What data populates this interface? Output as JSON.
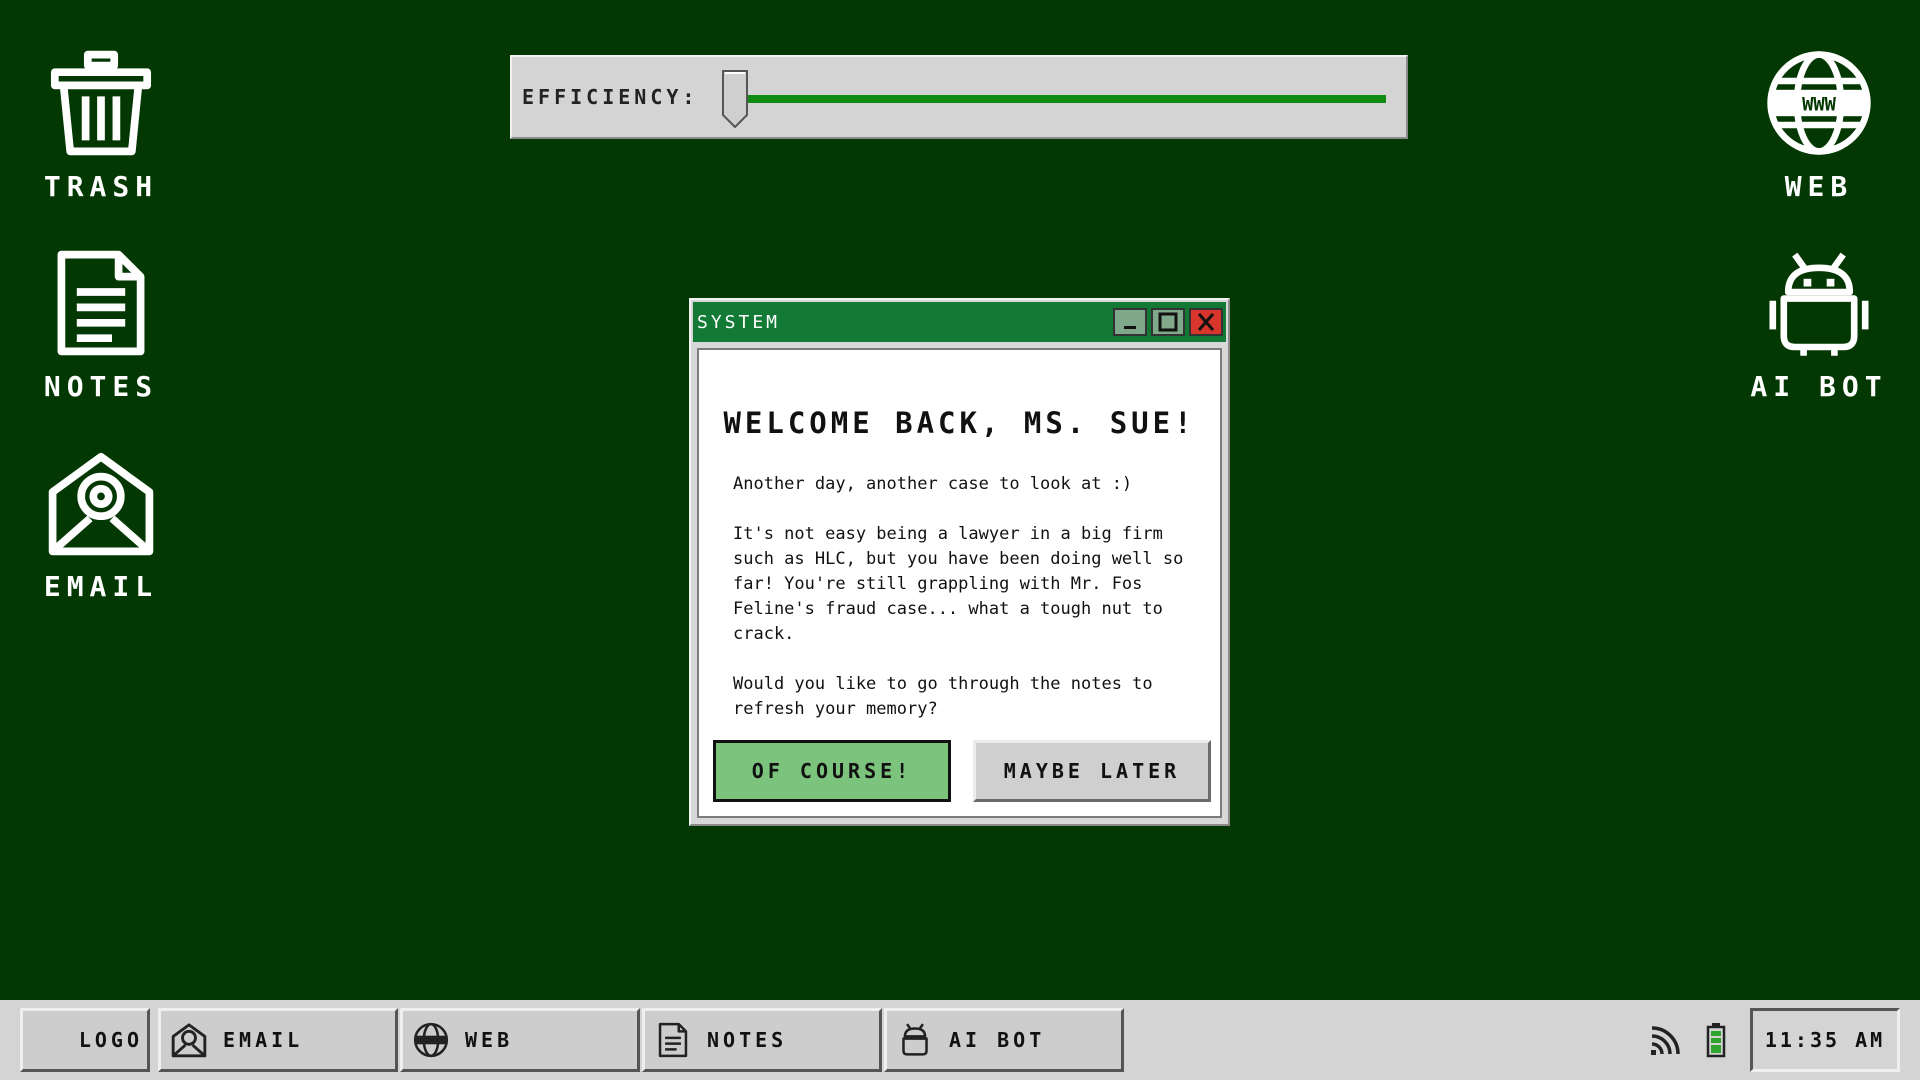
{
  "desktop": {
    "left_icons": [
      {
        "label": "TRASH",
        "icon": "trash-icon"
      },
      {
        "label": "NOTES",
        "icon": "notes-icon"
      },
      {
        "label": "EMAIL",
        "icon": "email-icon"
      }
    ],
    "right_icons": [
      {
        "label": "WEB",
        "icon": "web-globe-icon"
      },
      {
        "label": "AI BOT",
        "icon": "robot-icon"
      }
    ]
  },
  "efficiency": {
    "label": "EFFICIENCY:",
    "level_fraction": 0.02,
    "track_color": "#118a11"
  },
  "dialog": {
    "title": "SYSTEM",
    "heading": "WELCOME BACK, MS. SUE!",
    "paragraphs": [
      "Another day, another case to look at :)",
      "It's not easy being a lawyer in a big firm such as HLC, but you have been doing well so far! You're still grappling with Mr. Fos Feline's fraud case... what a tough nut to crack.",
      "Would you like to go through the notes to refresh your memory?"
    ],
    "confirm_label": "OF COURSE!",
    "decline_label": "MAYBE LATER",
    "titlebar_color": "#127a35",
    "confirm_color": "#7cc47e",
    "close_color": "#d8352c"
  },
  "taskbar": {
    "buttons": [
      {
        "label": "LOGO",
        "icon": ""
      },
      {
        "label": "EMAIL",
        "icon": "email-icon"
      },
      {
        "label": "WEB",
        "icon": "web-globe-icon"
      },
      {
        "label": "NOTES",
        "icon": "notes-icon"
      },
      {
        "label": "AI BOT",
        "icon": "robot-icon"
      }
    ],
    "tray": [
      "wifi-signal-icon",
      "battery-icon"
    ],
    "clock": "11:35 AM"
  },
  "colors": {
    "desktop_bg": "#033803",
    "taskbar_bg": "#d4d4d4"
  }
}
